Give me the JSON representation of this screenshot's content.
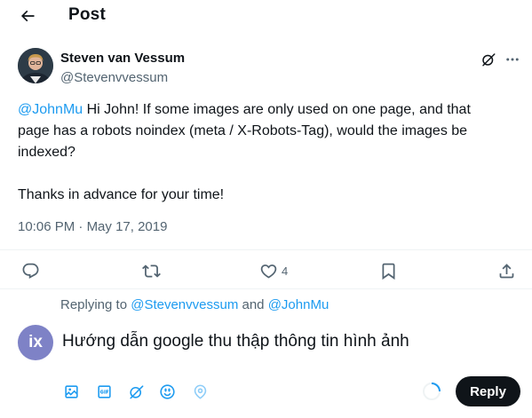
{
  "header": {
    "title": "Post"
  },
  "author": {
    "name": "Steven van Vessum",
    "handle": "@Stevenvvessum"
  },
  "tweet": {
    "line1_mention": "@JohnMu",
    "line1_text": " Hi John! If some images are only used on one page, and that",
    "line2": "page has a robots noindex (meta / X-Robots-Tag), would the images be",
    "line3": "indexed?",
    "line4": "Thanks in advance for your time!"
  },
  "timestamp": {
    "time": "10:06 PM",
    "separator": " · ",
    "date": "May 17, 2019"
  },
  "actions": {
    "reply_icon": "reply-icon",
    "repost_icon": "repost-icon",
    "like_icon": "heart-icon",
    "like_count": "4",
    "bookmark_icon": "bookmark-icon",
    "share_icon": "share-icon"
  },
  "reply": {
    "replying_prefix": "Replying to ",
    "mention1": "@Stevenvvessum",
    "and": " and ",
    "mention2": "@JohnMu",
    "avatar_initials": "ix",
    "input_text": "Hướng dẫn google thu thập thông tin hình ảnh",
    "button_label": "Reply"
  },
  "colors": {
    "accent": "#1d9bf0",
    "text_primary": "#0f1419",
    "text_secondary": "#536471",
    "reply_avatar_bg": "#7e82c6",
    "button_bg": "#0f1419"
  }
}
